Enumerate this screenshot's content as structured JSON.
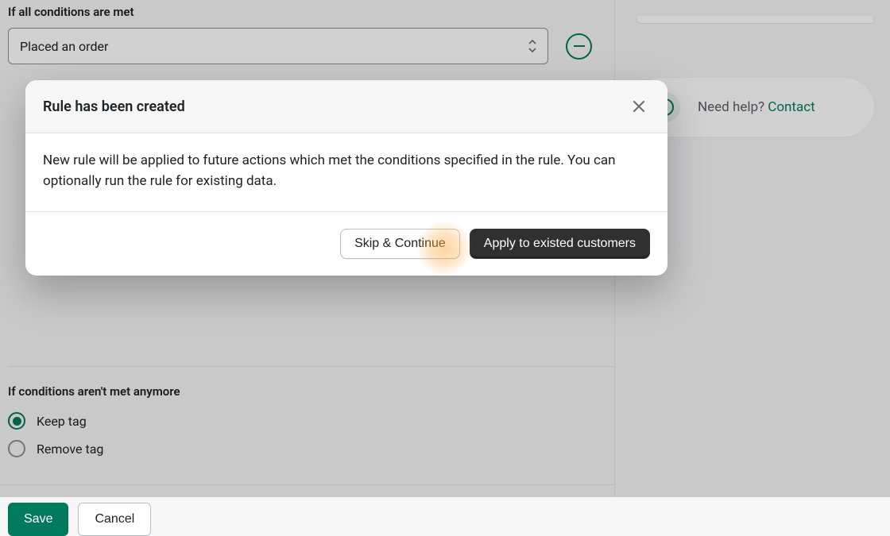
{
  "conditions": {
    "label": "If all conditions are met",
    "select_value": "Placed an order"
  },
  "not_met": {
    "label": "If conditions aren't met anymore",
    "options": [
      {
        "label": "Keep tag",
        "selected": true
      },
      {
        "label": "Remove tag",
        "selected": false
      }
    ]
  },
  "footer": {
    "save_label": "Save",
    "cancel_label": "Cancel"
  },
  "help": {
    "text": "Need help? ",
    "link_label": "Contact"
  },
  "modal": {
    "title": "Rule has been created",
    "body": "New rule will be applied to future actions which met the conditions specified in the rule. You can optionally run the rule for existing data.",
    "skip_label": "Skip & Continue",
    "apply_label": "Apply to existed customers"
  }
}
